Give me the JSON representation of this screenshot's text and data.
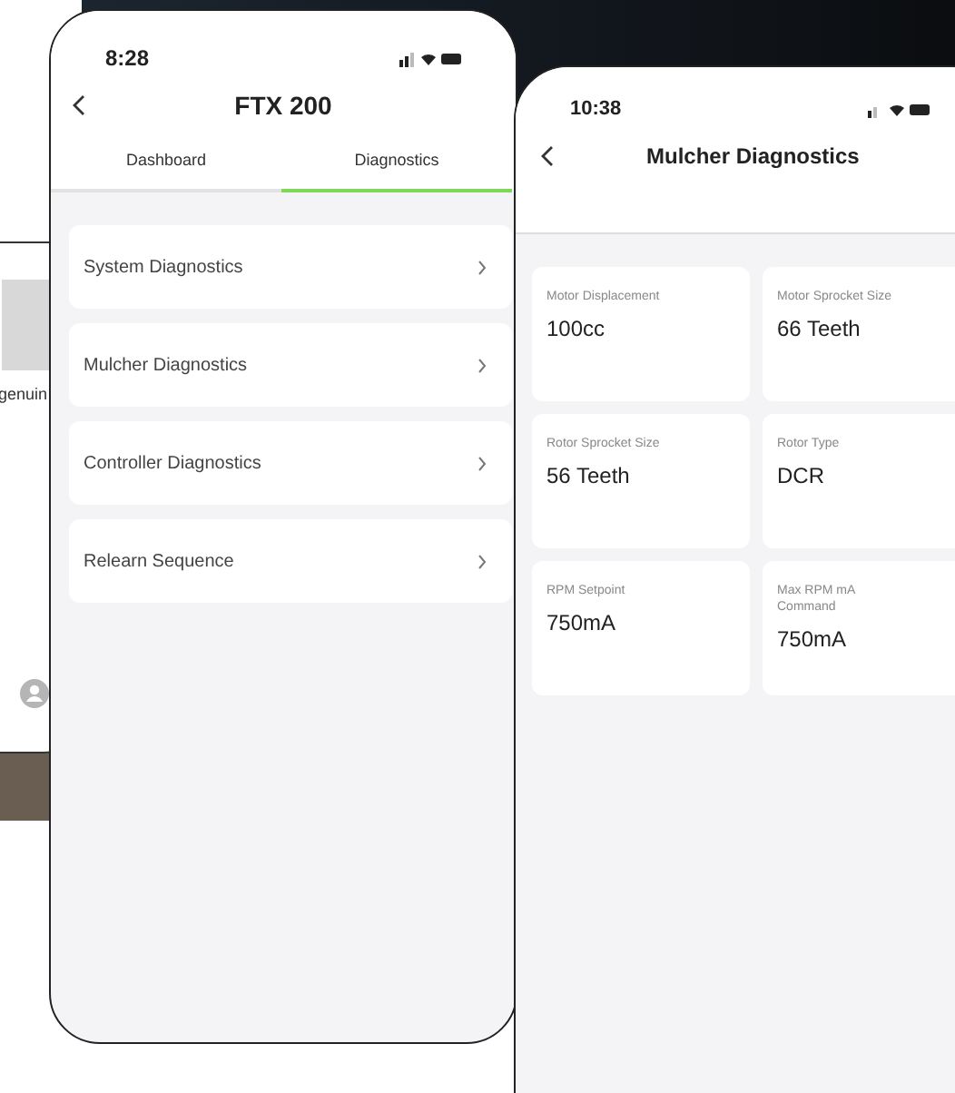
{
  "left_phone": {
    "text_fragment": "genuin"
  },
  "phone_1": {
    "status_time": "8:28",
    "title": "FTX 200",
    "tabs": [
      {
        "label": "Dashboard",
        "selected": false
      },
      {
        "label": "Diagnostics",
        "selected": true
      }
    ],
    "items": [
      {
        "label": "System Diagnostics"
      },
      {
        "label": "Mulcher Diagnostics"
      },
      {
        "label": "Controller Diagnostics"
      },
      {
        "label": "Relearn Sequence"
      }
    ]
  },
  "phone_2": {
    "status_time": "10:38",
    "title": "Mulcher Diagnostics",
    "cards": [
      {
        "label": "Motor Displacement",
        "value": "100cc"
      },
      {
        "label": "Motor Sprocket Size",
        "value": "66 Teeth"
      },
      {
        "label": "Rotor Sprocket Size",
        "value": "56 Teeth"
      },
      {
        "label": "Rotor Type",
        "value": "DCR"
      },
      {
        "label": "RPM Setpoint",
        "value": "750mA"
      },
      {
        "label": "Max RPM mA Command",
        "value": "750mA"
      }
    ]
  }
}
